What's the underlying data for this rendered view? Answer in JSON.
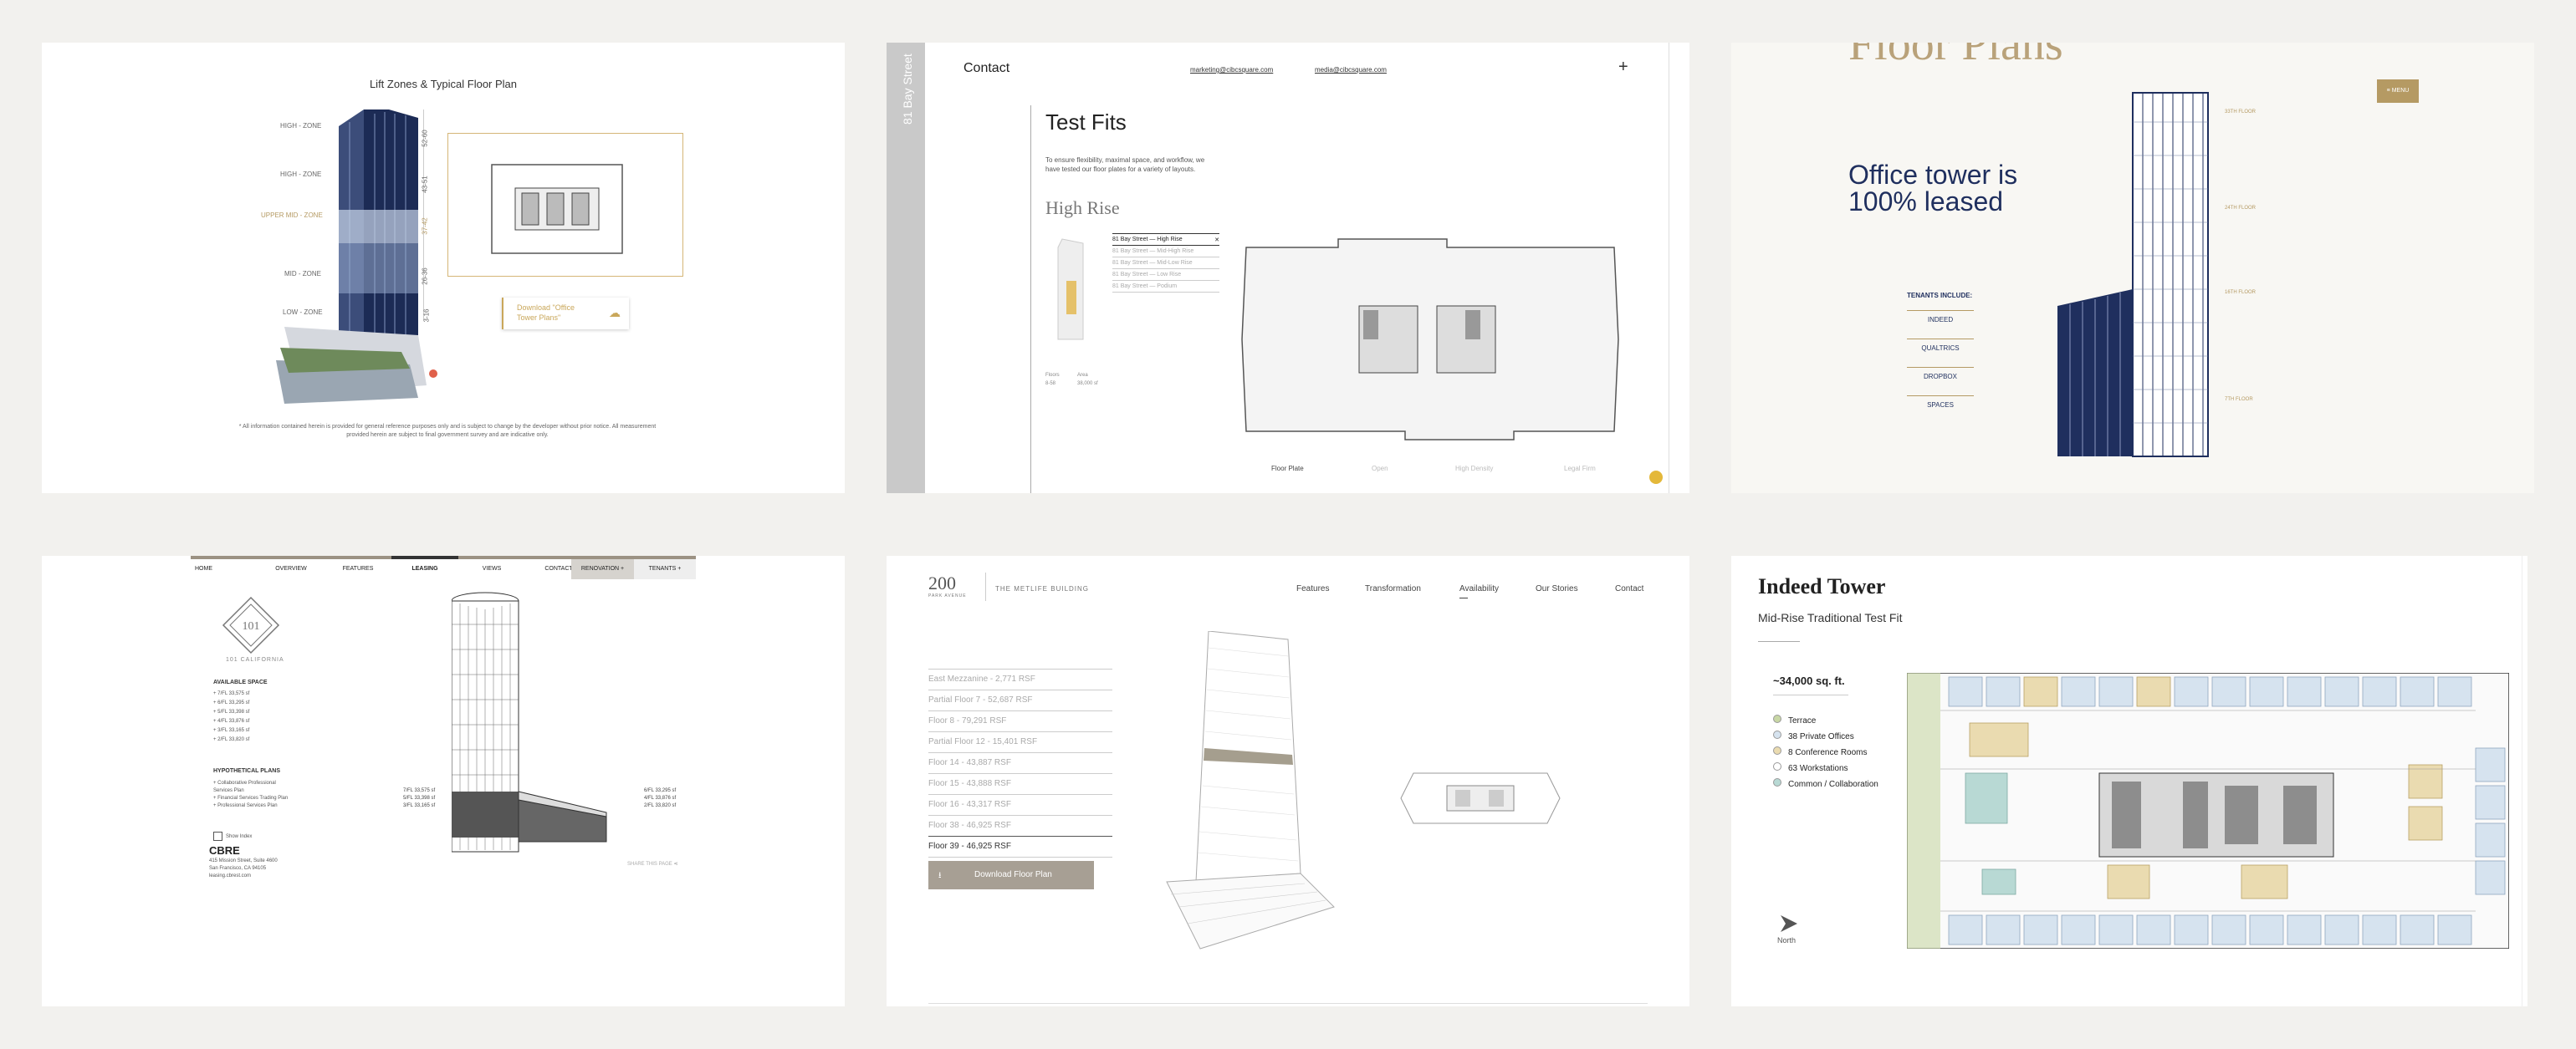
{
  "card1": {
    "title": "Lift Zones & Typical Floor Plan",
    "zones": [
      "HIGH - ZONE",
      "HIGH - ZONE",
      "UPPER MID - ZONE",
      "MID - ZONE",
      "LOW - ZONE"
    ],
    "floor_ranges": [
      "52-60",
      "43-51",
      "37-42",
      "26-36",
      "3-16"
    ],
    "download_label": "Download \"Office Tower Plans\"",
    "disclaimer": "* All information contained herein is provided for general reference purposes only and is subject to change by the developer without prior notice. All measurement provided herein are subject to final government survey and are indicative only."
  },
  "card2": {
    "side_label": "81 Bay Street",
    "contact_label": "Contact",
    "email1": "marketing@cibcsquare.com",
    "email2": "media@cibcsquare.com",
    "plus": "+",
    "heading": "Test Fits",
    "intro": "To ensure flexibility, maximal space, and workflow, we have tested our floor plates for a variety of layouts.",
    "subheading": "High Rise",
    "options": [
      "81 Bay Street — High Rise",
      "81 Bay Street — Mid-High Rise",
      "81 Bay Street — Mid-Low Rise",
      "81 Bay Street — Low Rise",
      "81 Bay Street — Podium"
    ],
    "stat_labels": [
      "Floors",
      "Area"
    ],
    "stat_values": [
      "8-58",
      "38,000 sf"
    ],
    "tabs": [
      "Floor Plate",
      "Open",
      "High Density",
      "Legal Firm"
    ]
  },
  "card3": {
    "page_title": "Floor Plans",
    "menu_label": "≡ MENU",
    "headline_line1": "Office tower is",
    "headline_line2": "100% leased",
    "tenants_label": "TENANTS INCLUDE:",
    "tenants": [
      "INDEED",
      "QUALTRICS",
      "DROPBOX",
      "SPACES"
    ],
    "floor_tags": [
      "33TH FLOOR",
      "24TH FLOOR",
      "16TH FLOOR",
      "7TH FLOOR"
    ]
  },
  "card4": {
    "nav": [
      "HOME",
      "OVERVIEW",
      "FEATURES",
      "LEASING",
      "VIEWS",
      "CONTACT",
      "RENOVATION +",
      "TENANTS +"
    ],
    "brand": "101 CALIFORNIA",
    "available_heading": "AVAILABLE SPACE",
    "available": [
      "7/FL 33,575 sf",
      "6/FL 33,295 sf",
      "5/FL 33,398 sf",
      "4/FL 33,876 sf",
      "3/FL 33,165 sf",
      "2/FL 33,820 sf"
    ],
    "hypo_heading": "HYPOTHETICAL PLANS",
    "hypo": [
      "Collaborative Professional Services Plan",
      "Financial Services Trading Plan",
      "Professional Services Plan"
    ],
    "show_index": "Show Index",
    "left_labels": [
      "7/FL 33,575 sf",
      "5/FL 33,398 sf",
      "3/FL 33,165 sf"
    ],
    "right_labels": [
      "6/FL 33,295 sf",
      "4/FL 33,876 sf",
      "2/FL 33,820 sf"
    ],
    "broker": "CBRE",
    "broker_address": "415 Mission Street, Suite 4600",
    "broker_city": "San Francisco, CA 94105",
    "broker_site": "leasing.cbrest.com",
    "share_label": "SHARE THIS PAGE"
  },
  "card5": {
    "logo_number": "200",
    "logo_sub": "PARK AVENUE",
    "building_name": "THE METLIFE BUILDING",
    "nav": [
      "Features",
      "Transformation",
      "Availability",
      "Our Stories",
      "Contact"
    ],
    "floors": [
      "East Mezzanine - 2,771 RSF",
      "Partial Floor 7 - 52,687 RSF",
      "Floor 8 - 79,291 RSF",
      "Partial Floor 12 - 15,401 RSF",
      "Floor 14 - 43,887 RSF",
      "Floor 15 - 43,888 RSF",
      "Floor 16 - 43,317 RSF",
      "Floor 38 - 46,925 RSF",
      "Floor 39 - 46,925 RSF"
    ],
    "download_label": "Download Floor Plan"
  },
  "card6": {
    "title": "Indeed Tower",
    "subtitle": "Mid-Rise Traditional Test Fit",
    "area": "~34,000 sq. ft.",
    "legend": [
      "Terrace",
      "38 Private Offices",
      "8 Conference Rooms",
      "63 Workstations",
      "Common / Collaboration"
    ],
    "legend_colors": [
      "#c8d7a5",
      "#d6e3ef",
      "#eadbb0",
      "#ffffff",
      "#b8d9d4"
    ],
    "north_label": "North"
  },
  "colors": {
    "gold": "#b59a63",
    "navy": "#1f2f5e",
    "taupe": "#a79f94"
  }
}
